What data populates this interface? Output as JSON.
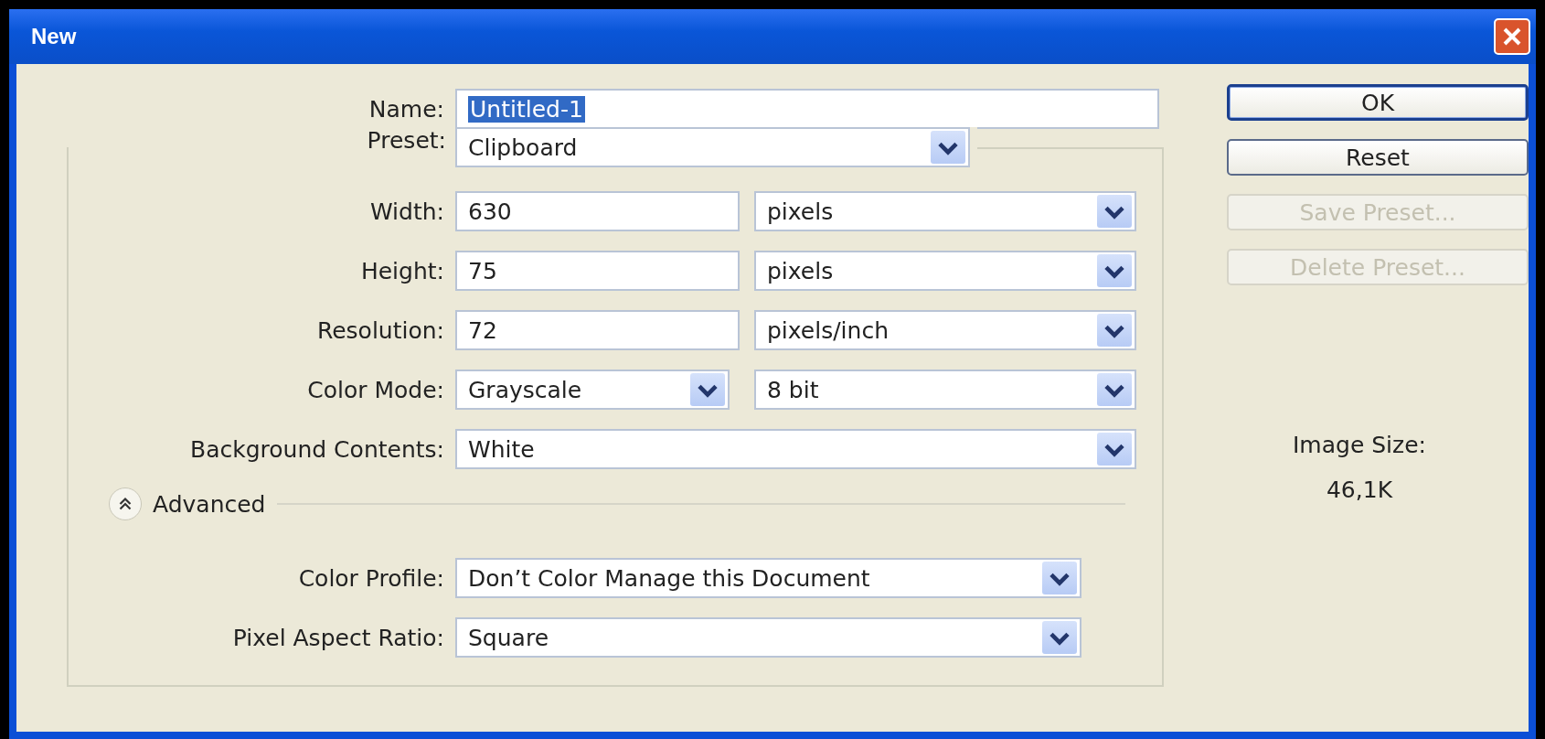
{
  "window": {
    "title": "New"
  },
  "name": {
    "label": "Name:",
    "value": "Untitled-1",
    "selected": true
  },
  "preset": {
    "label": "Preset:",
    "value": "Clipboard"
  },
  "rows": [
    {
      "label": "Width:",
      "kind": "number_unit",
      "value": "630",
      "unit": "pixels"
    },
    {
      "label": "Height:",
      "kind": "number_unit",
      "value": "75",
      "unit": "pixels"
    },
    {
      "label": "Resolution:",
      "kind": "number_unit",
      "value": "72",
      "unit": "pixels/inch"
    },
    {
      "label": "Color Mode:",
      "kind": "select_pair",
      "value": "Grayscale",
      "unit": "8 bit"
    },
    {
      "label": "Background Contents:",
      "kind": "select",
      "value": "White"
    }
  ],
  "advanced": {
    "label": "Advanced",
    "expanded": true
  },
  "advanced_rows": [
    {
      "label": "Color Profile:",
      "value": "Don’t Color Manage this Document"
    },
    {
      "label": "Pixel Aspect Ratio:",
      "value": "Square"
    }
  ],
  "buttons": [
    {
      "label": "OK",
      "default": true,
      "disabled": false
    },
    {
      "label": "Reset",
      "default": false,
      "disabled": false
    },
    {
      "label": "Save Preset...",
      "default": false,
      "disabled": true
    },
    {
      "label": "Delete Preset...",
      "default": false,
      "disabled": true
    }
  ],
  "image_size": {
    "label": "Image Size:",
    "value": "46,1K"
  }
}
